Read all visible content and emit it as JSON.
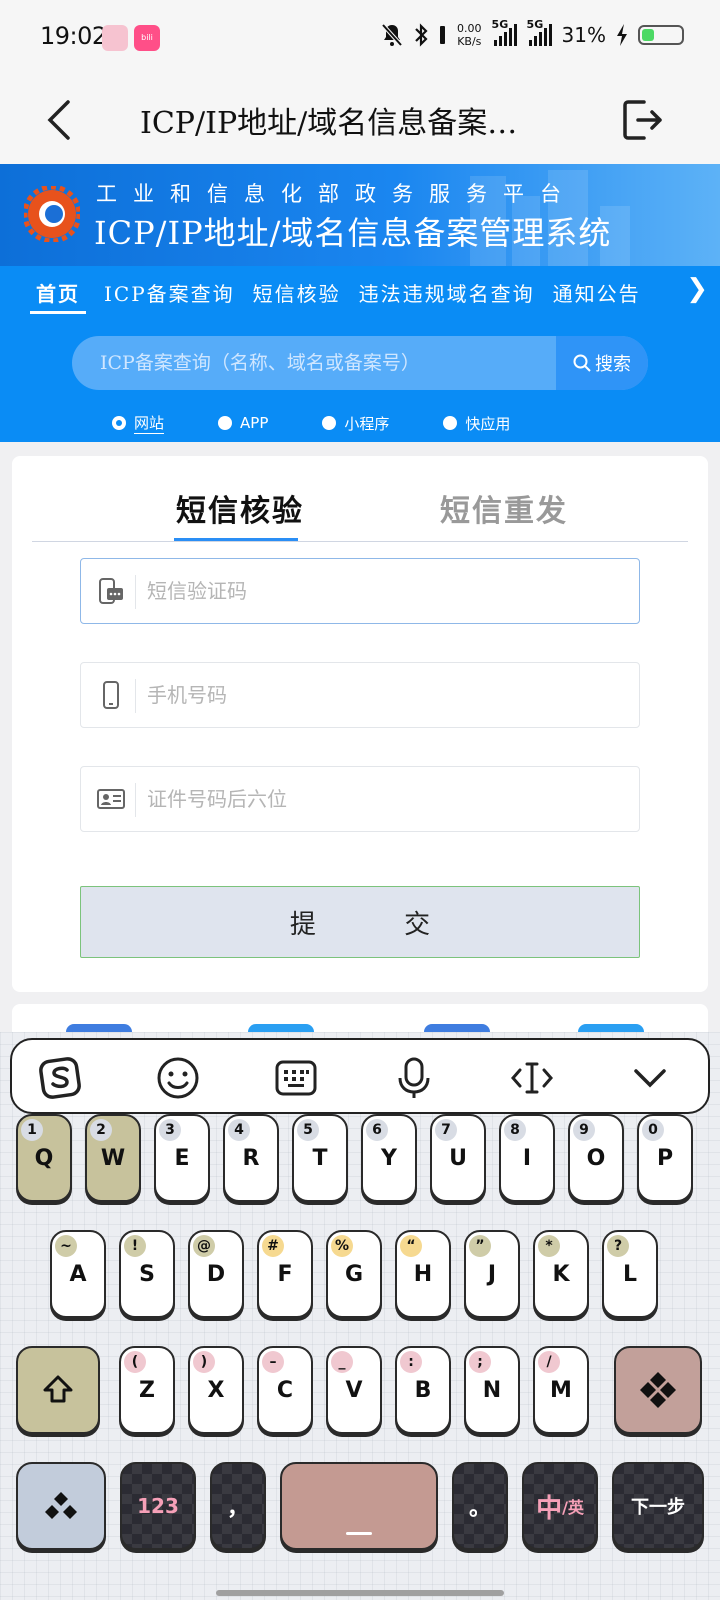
{
  "status_bar": {
    "time": "19:02",
    "net_speed_value": "0.00",
    "net_speed_unit": "KB/s",
    "sim1": "5G",
    "sim2": "5G",
    "battery": "31%",
    "battery_level": 0.31
  },
  "header": {
    "title": "ICP/IP地址/域名信息备案…"
  },
  "banner": {
    "subtitle": "工业和信息化部政务服务平台",
    "title": "ICP/IP地址/域名信息备案管理系统"
  },
  "menu": {
    "items": [
      "首页",
      "ICP备案查询",
      "短信核验",
      "违法违规域名查询",
      "通知公告"
    ],
    "active_index": 0
  },
  "search": {
    "placeholder": "ICP备案查询（名称、域名或备案号）",
    "button_label": "搜索"
  },
  "radios": {
    "options": [
      "网站",
      "APP",
      "小程序",
      "快应用"
    ],
    "selected_index": 0
  },
  "form": {
    "tabs": [
      "短信核验",
      "短信重发"
    ],
    "active_tab": 0,
    "fields": [
      {
        "placeholder": "短信验证码",
        "value": ""
      },
      {
        "placeholder": "手机号码",
        "value": ""
      },
      {
        "placeholder": "证件号码后六位",
        "value": ""
      }
    ],
    "submit_label": "提 交"
  },
  "keyboard": {
    "row1": [
      {
        "key": "Q",
        "num": "1"
      },
      {
        "key": "W",
        "num": "2"
      },
      {
        "key": "E",
        "num": "3"
      },
      {
        "key": "R",
        "num": "4"
      },
      {
        "key": "T",
        "num": "5"
      },
      {
        "key": "Y",
        "num": "6"
      },
      {
        "key": "U",
        "num": "7"
      },
      {
        "key": "I",
        "num": "8"
      },
      {
        "key": "O",
        "num": "9"
      },
      {
        "key": "P",
        "num": "0"
      }
    ],
    "row2": [
      {
        "key": "A",
        "num": "~"
      },
      {
        "key": "S",
        "num": "!"
      },
      {
        "key": "D",
        "num": "@"
      },
      {
        "key": "F",
        "num": "#"
      },
      {
        "key": "G",
        "num": "%"
      },
      {
        "key": "H",
        "num": "“"
      },
      {
        "key": "J",
        "num": "”"
      },
      {
        "key": "K",
        "num": "*"
      },
      {
        "key": "L",
        "num": "?"
      }
    ],
    "row3": [
      {
        "key": "Z",
        "num": "("
      },
      {
        "key": "X",
        "num": ")"
      },
      {
        "key": "C",
        "num": "–"
      },
      {
        "key": "V",
        "num": "_"
      },
      {
        "key": "B",
        "num": ":"
      },
      {
        "key": "N",
        "num": ";"
      },
      {
        "key": "M",
        "num": "/"
      }
    ],
    "num_key": "123",
    "comma_key": "，",
    "period_key": "。",
    "lang_key_main": "中",
    "lang_key_sub": "/英",
    "next_key": "下一步"
  },
  "colors": {
    "primary_blue": "#0a8cf5",
    "banner_blue": "#0d6fd8",
    "tab_accent": "#2a8ef5"
  }
}
